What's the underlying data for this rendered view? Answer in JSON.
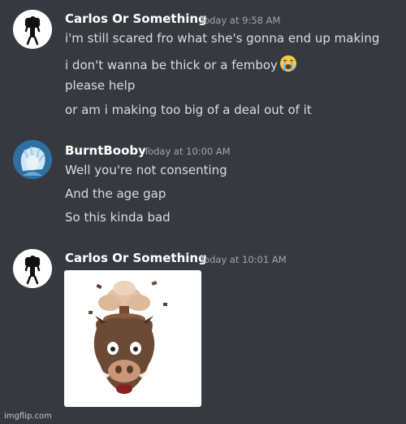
{
  "messages": [
    {
      "username": "Carlos Or Something",
      "timestamp": "Today at 9:58 AM",
      "avatar_icon": "black-figure-avatar-icon",
      "lines": [
        "i'm still scared fro what she's gonna end up making",
        "i don't wanna be thick or a femboy",
        "please help",
        "or am i making too big of a deal out of it"
      ],
      "emoji": "loudly-crying-face-icon"
    },
    {
      "username": "BurntBooby",
      "timestamp": "Today at 10:00 AM",
      "avatar_icon": "anime-character-avatar-icon",
      "lines": [
        "Well you're not consenting",
        "And the age gap",
        "So this kinda bad"
      ]
    },
    {
      "username": "Carlos Or Something",
      "timestamp": "Today at 10:01 AM",
      "avatar_icon": "black-figure-avatar-icon",
      "attachment_icon": "mind-blown-boar-emoji-icon"
    }
  ],
  "watermark": "imgflip.com",
  "colors": {
    "background": "#36393f",
    "username": "#ffffff",
    "message_text": "#dcddde",
    "timestamp": "#a3a6aa"
  }
}
